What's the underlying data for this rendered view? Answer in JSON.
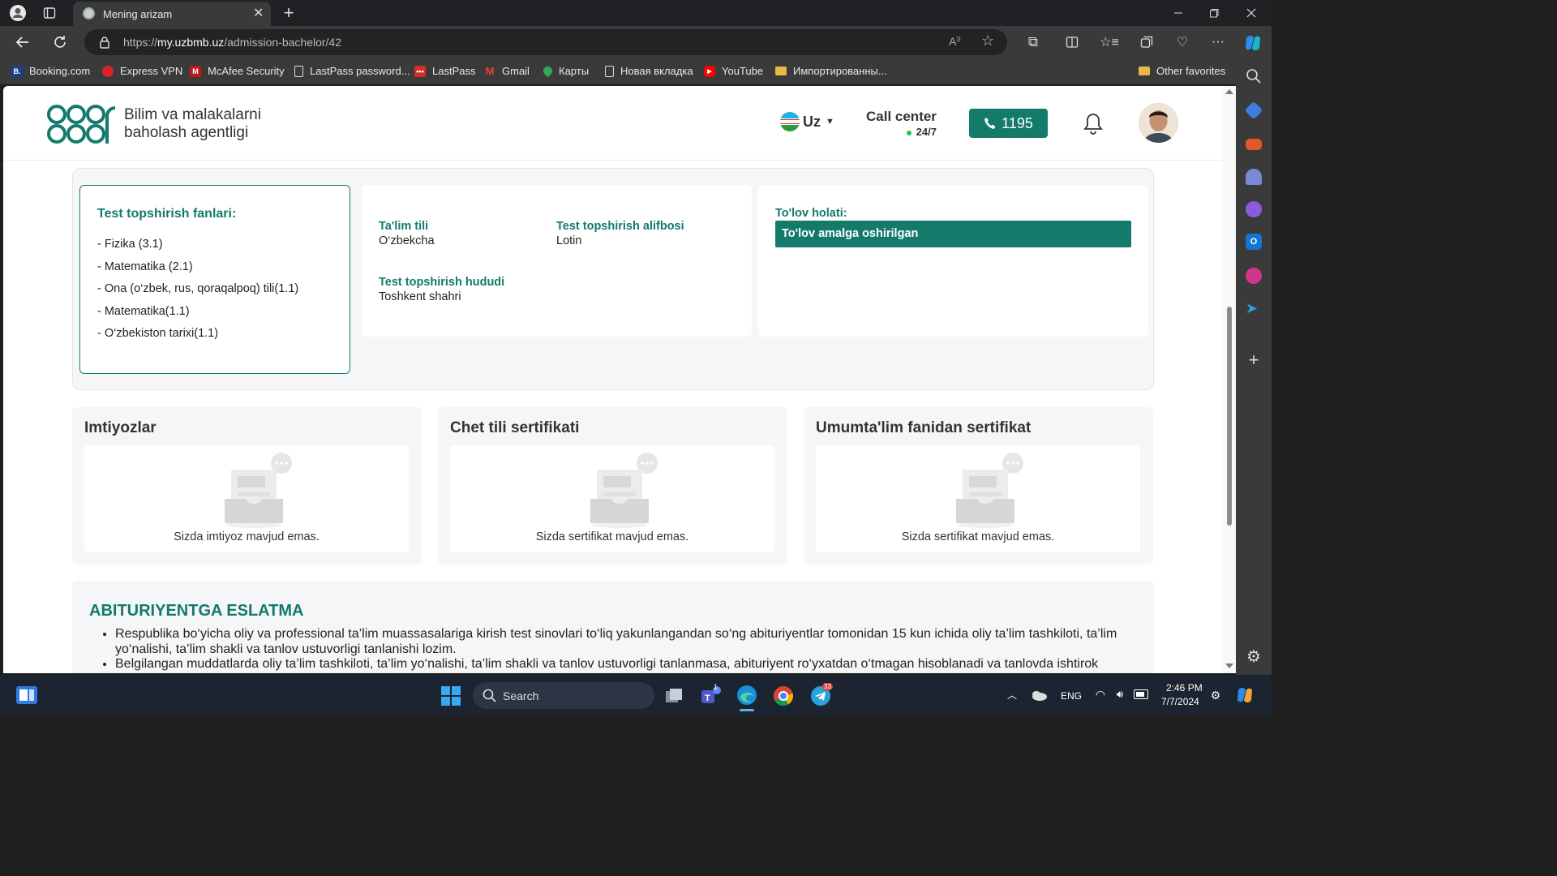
{
  "browser": {
    "tab_title": "Mening arizam",
    "url_prefix": "https://",
    "url_domain": "my.uzbmb.uz",
    "url_path": "/admission-bachelor/42"
  },
  "bookmarks": [
    {
      "label": "Booking.com",
      "icon": "booking-icon",
      "color": "#1a3f8f"
    },
    {
      "label": "Express VPN",
      "icon": "expressvpn-icon",
      "color": "#d9232d"
    },
    {
      "label": "McAfee Security",
      "icon": "mcafee-icon",
      "color": "#c01818"
    },
    {
      "label": "LastPass password...",
      "icon": "page-icon",
      "color": "#3a3a3a"
    },
    {
      "label": "LastPass",
      "icon": "lastpass-icon",
      "color": "#d32d27"
    },
    {
      "label": "Gmail",
      "icon": "gmail-icon",
      "color": "#ea4335"
    },
    {
      "label": "Карты",
      "icon": "maps-icon",
      "color": "#34a853"
    },
    {
      "label": "Новая вкладка",
      "icon": "page-icon",
      "color": "#3a3a3a"
    },
    {
      "label": "YouTube",
      "icon": "youtube-icon",
      "color": "#ff0000"
    },
    {
      "label": "Импортированны...",
      "icon": "folder-icon",
      "color": "#e8b84a"
    }
  ],
  "bookmarks_other": "Other favorites",
  "header": {
    "logo_line1": "Bilim va malakalarni",
    "logo_line2": "baholash agentligi",
    "language": "Uz",
    "call_center": "Call center",
    "call_hours": "24/7",
    "phone": "1195"
  },
  "subjects": {
    "title": "Test topshirish fanlari:",
    "items": [
      "- Fizika (3.1)",
      "- Matematika (2.1)",
      "- Ona (o‘zbek, rus, qoraqalpoq) tili(1.1)",
      "- Matematika(1.1)",
      "- O‘zbekiston tarixi(1.1)"
    ]
  },
  "details": {
    "edu_lang_label": "Ta'lim tili",
    "edu_lang_value": "O‘zbekcha",
    "alphabet_label": "Test topshirish alifbosi",
    "alphabet_value": "Lotin",
    "region_label": "Test topshirish hududi",
    "region_value": "Toshkent shahri"
  },
  "payment": {
    "label": "To'lov holati:",
    "status": "To'lov amalga oshirilgan"
  },
  "cards": [
    {
      "title": "Imtiyozlar",
      "message": "Sizda imtiyoz mavjud emas."
    },
    {
      "title": "Chet tili sertifikati",
      "message": "Sizda sertifikat mavjud emas."
    },
    {
      "title": "Umumta'lim fanidan sertifikat",
      "message": "Sizda sertifikat mavjud emas."
    }
  ],
  "note": {
    "title": "ABITURIYENTGA ESLATMA",
    "items": [
      "Respublika bo‘yicha oliy va professional ta’lim muassasalariga kirish test sinovlari to‘liq yakunlangandan so‘ng abituriyentlar tomonidan 15 kun ichida oliy ta’lim tashkiloti, ta’lim yo‘nalishi, ta’lim shakli va tanlov ustuvorligi tanlanishi lozim.",
      "Belgilangan muddatlarda oliy ta’lim tashkiloti, ta’lim yo‘nalishi, ta’lim shakli va tanlov ustuvorligi tanlanmasa, abituriyent ro‘yxatdan o‘tmagan hisoblanadi va tanlovda ishtirok"
    ]
  },
  "taskbar": {
    "search": "Search",
    "lang": "ENG",
    "time": "2:46 PM",
    "date": "7/7/2024",
    "teams_badge": "1",
    "telegram_badge": "33"
  },
  "colors": {
    "brand": "#147a6a"
  }
}
